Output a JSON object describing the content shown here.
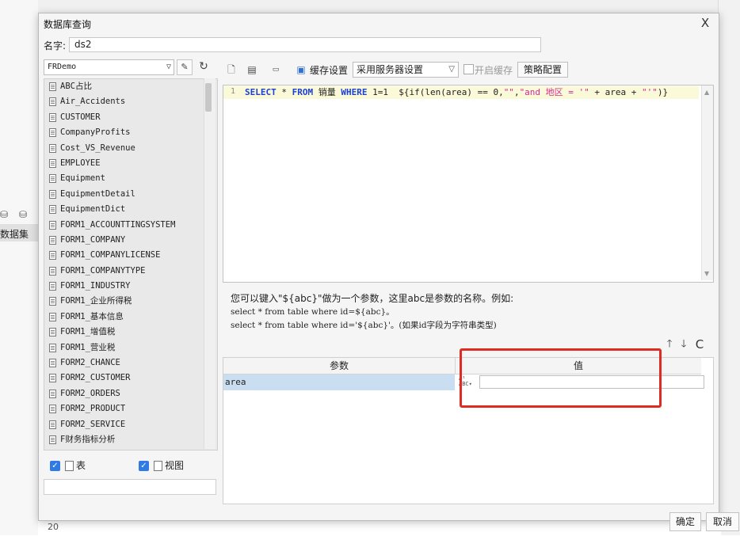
{
  "dialog": {
    "title": "数据库查询",
    "close_label": "X",
    "name_label": "名字:",
    "name_value": "ds2"
  },
  "left_panel": {
    "database": "FRDemo",
    "tables": [
      "ABC占比",
      "Air_Accidents",
      "CUSTOMER",
      "CompanyProfits",
      "Cost_VS_Revenue",
      "EMPLOYEE",
      "Equipment",
      "EquipmentDetail",
      "EquipmentDict",
      "FORM1_ACCOUNTTINGSYSTEM",
      "FORM1_COMPANY",
      "FORM1_COMPANYLICENSE",
      "FORM1_COMPANYTYPE",
      "FORM1_INDUSTRY",
      "FORM1_企业所得税",
      "FORM1_基本信息",
      "FORM1_增值税",
      "FORM1_营业税",
      "FORM2_CHANCE",
      "FORM2_CUSTOMER",
      "FORM2_ORDERS",
      "FORM2_PRODUCT",
      "FORM2_SERVICE",
      "F财务指标分析"
    ],
    "table_checkbox_label": "表",
    "view_checkbox_label": "视图"
  },
  "toolbar": {
    "cache_settings_label": "缓存设置",
    "cache_mode_value": "采用服务器设置",
    "enable_cache_label": "开启缓存",
    "strategy_label": "策略配置"
  },
  "editor": {
    "line_number": "1",
    "sql_select": "SELECT",
    "sql_star": " * ",
    "sql_from": "FROM",
    "sql_table": " 销量 ",
    "sql_where": "WHERE",
    "sql_cond": " 1=1  ${if(len(area) == 0,",
    "sql_str1": "\"\"",
    "sql_comma": ",",
    "sql_str2": "\"and 地区 = '\"",
    "sql_plus1": " + area + ",
    "sql_str3": "\"'\"",
    "sql_close": ")}"
  },
  "hint": {
    "line1": "您可以键入\"${abc}\"做为一个参数，这里abc是参数的名称。例如:",
    "line2": "select * from table where id=${abc}。",
    "line3": "select * from table where id='${abc}'。(如果id字段为字符串类型)"
  },
  "params": {
    "col_param": "参数",
    "col_value": "值",
    "rows": [
      {
        "name": "area",
        "value": ""
      }
    ]
  },
  "buttons": {
    "ok": "确定",
    "cancel": "取消"
  },
  "background": {
    "left_tab": "数据集",
    "bottom_row": "20"
  },
  "colors": {
    "highlight": "#e02b22",
    "sql_keyword": "#1b3fd8",
    "sql_string": "#d6289a",
    "selected_row": "#c9dff1",
    "checkbox": "#2f7ae5"
  }
}
